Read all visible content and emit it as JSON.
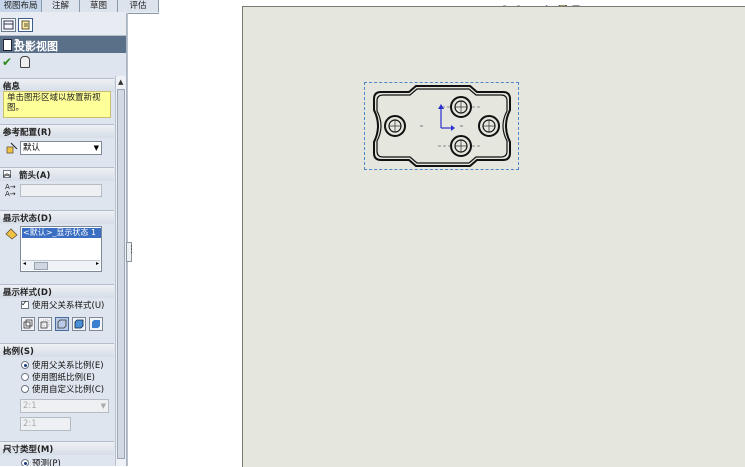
{
  "tabs": [
    "视图布局",
    "注解",
    "草图",
    "评估"
  ],
  "property_manager": {
    "title": "投影视图",
    "help": "?",
    "sections": {
      "info": {
        "header": "信息",
        "text": "单击图形区域以放置新视图。"
      },
      "reference_config": {
        "header": "参考配置(R)",
        "value": "默认"
      },
      "arrow": {
        "header": "箭头(A)"
      },
      "display_state": {
        "header": "显示状态(D)",
        "selected_item": "<默认>_显示状态 1"
      },
      "display_style": {
        "header": "显示样式(D)",
        "use_parent_style": "使用父关系样式(U)"
      },
      "scale": {
        "header": "比例(S)",
        "options": [
          "使用父关系比例(E)",
          "使用图纸比例(E)",
          "使用自定义比例(C)"
        ],
        "selected_index": 0,
        "custom_combo": "2:1",
        "custom_input": "2:1"
      },
      "dimension_type": {
        "header": "尺寸类型(M)",
        "option": "预测(P)"
      }
    }
  },
  "icons": [
    "feature-manager-icon",
    "property-manager-icon",
    "ok-icon",
    "pushpin-icon",
    "config-icon",
    "arrow-label-icon",
    "display-state-icon",
    "zoom-to-fit-icon",
    "zoom-area-icon",
    "previous-view-icon",
    "rotate-icon",
    "view-orientation-icon",
    "display-style-icon",
    "hide-show-icon"
  ],
  "colors": {
    "panel_title_bg": "#5a6f88",
    "info_bg": "#ffff9a",
    "canvas_bg": "#e5e6dd",
    "selection_frame": "#4f86c8",
    "list_selected": "#3a6ec2"
  }
}
